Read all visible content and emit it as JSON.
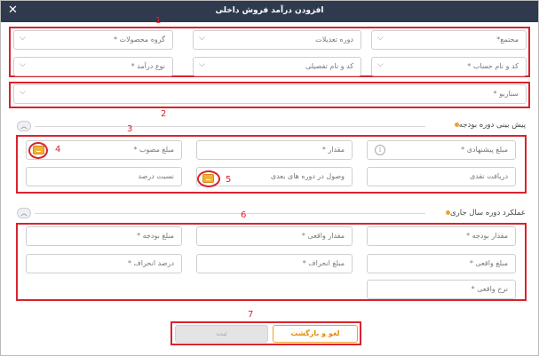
{
  "dialog": {
    "title": "افزودن درآمد فروش داخلی",
    "close_glyph": "✕"
  },
  "annotations": {
    "n1": "1",
    "n2": "2",
    "n3": "3",
    "n4": "4",
    "n5": "5",
    "n6": "6",
    "n7": "7"
  },
  "filters": {
    "complex": "مجتمع*",
    "adjustment_period": "دوره تعدیلات",
    "product_group": "گروه محصولات *",
    "account_code": "کد و نام حساب *",
    "detail_code": "کد و نام تفصیلی",
    "income_type": "نوع درآمد *"
  },
  "scenario": {
    "label": "سناریو *"
  },
  "budget_forecast": {
    "title": "پیش بینی دوره بودجه",
    "proposed_amount": "مبلغ پیشنهادی *",
    "quantity": "مقدار *",
    "approved_amount": "مبلغ مصوب *",
    "cash_receipt": "دریافت نقدی",
    "future_receipt": "وصول در دوره های بعدی",
    "percent_ratio": "نسبت درصد"
  },
  "current_year": {
    "title": "عملکرد دوره سال جاری",
    "budget_quantity": "مقدار بودجه *",
    "actual_quantity": "مقدار واقعی *",
    "budget_amount": "مبلغ بودجه *",
    "actual_amount": "مبلغ واقعی *",
    "deviation_amount": "مبلغ انحراف *",
    "deviation_percent": "درصد انحراف *",
    "actual_rate": "نرخ واقعی *"
  },
  "footer": {
    "cancel_label": "لغو و بازگشت",
    "save_label": "ثبت"
  },
  "icons": {
    "chevron": "chevron-down-icon",
    "collapse": "chevron-up-icon",
    "info": "info-icon",
    "doc": "document-icon"
  },
  "colors": {
    "titlebar": "#2f3a4f",
    "annotation": "#d9232e",
    "accent": "#f0a030"
  }
}
